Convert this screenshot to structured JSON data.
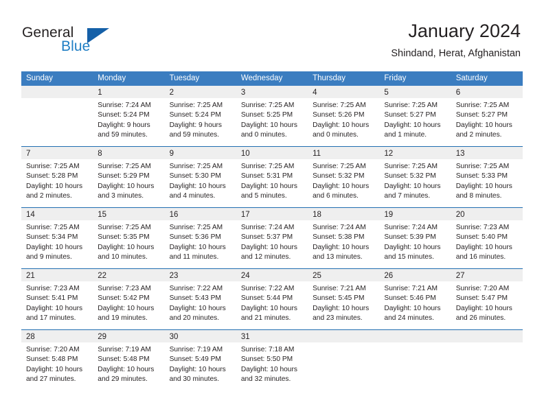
{
  "brand": {
    "name_part1": "General",
    "name_part2": "Blue",
    "accent_color": "#1f7ec4",
    "triangle_color": "#1560a8"
  },
  "header": {
    "title": "January 2024",
    "location": "Shindand, Herat, Afghanistan"
  },
  "theme": {
    "header_blue": "#3b7dc0",
    "row_separator_blue": "#1f6cb0",
    "date_band_gray": "#efefef",
    "text_color": "#231f20"
  },
  "weekdays": [
    "Sunday",
    "Monday",
    "Tuesday",
    "Wednesday",
    "Thursday",
    "Friday",
    "Saturday"
  ],
  "weeks": [
    [
      {
        "day": "",
        "lines": []
      },
      {
        "day": "1",
        "lines": [
          "Sunrise: 7:24 AM",
          "Sunset: 5:24 PM",
          "Daylight: 9 hours",
          "and 59 minutes."
        ]
      },
      {
        "day": "2",
        "lines": [
          "Sunrise: 7:25 AM",
          "Sunset: 5:24 PM",
          "Daylight: 9 hours",
          "and 59 minutes."
        ]
      },
      {
        "day": "3",
        "lines": [
          "Sunrise: 7:25 AM",
          "Sunset: 5:25 PM",
          "Daylight: 10 hours",
          "and 0 minutes."
        ]
      },
      {
        "day": "4",
        "lines": [
          "Sunrise: 7:25 AM",
          "Sunset: 5:26 PM",
          "Daylight: 10 hours",
          "and 0 minutes."
        ]
      },
      {
        "day": "5",
        "lines": [
          "Sunrise: 7:25 AM",
          "Sunset: 5:27 PM",
          "Daylight: 10 hours",
          "and 1 minute."
        ]
      },
      {
        "day": "6",
        "lines": [
          "Sunrise: 7:25 AM",
          "Sunset: 5:27 PM",
          "Daylight: 10 hours",
          "and 2 minutes."
        ]
      }
    ],
    [
      {
        "day": "7",
        "lines": [
          "Sunrise: 7:25 AM",
          "Sunset: 5:28 PM",
          "Daylight: 10 hours",
          "and 2 minutes."
        ]
      },
      {
        "day": "8",
        "lines": [
          "Sunrise: 7:25 AM",
          "Sunset: 5:29 PM",
          "Daylight: 10 hours",
          "and 3 minutes."
        ]
      },
      {
        "day": "9",
        "lines": [
          "Sunrise: 7:25 AM",
          "Sunset: 5:30 PM",
          "Daylight: 10 hours",
          "and 4 minutes."
        ]
      },
      {
        "day": "10",
        "lines": [
          "Sunrise: 7:25 AM",
          "Sunset: 5:31 PM",
          "Daylight: 10 hours",
          "and 5 minutes."
        ]
      },
      {
        "day": "11",
        "lines": [
          "Sunrise: 7:25 AM",
          "Sunset: 5:32 PM",
          "Daylight: 10 hours",
          "and 6 minutes."
        ]
      },
      {
        "day": "12",
        "lines": [
          "Sunrise: 7:25 AM",
          "Sunset: 5:32 PM",
          "Daylight: 10 hours",
          "and 7 minutes."
        ]
      },
      {
        "day": "13",
        "lines": [
          "Sunrise: 7:25 AM",
          "Sunset: 5:33 PM",
          "Daylight: 10 hours",
          "and 8 minutes."
        ]
      }
    ],
    [
      {
        "day": "14",
        "lines": [
          "Sunrise: 7:25 AM",
          "Sunset: 5:34 PM",
          "Daylight: 10 hours",
          "and 9 minutes."
        ]
      },
      {
        "day": "15",
        "lines": [
          "Sunrise: 7:25 AM",
          "Sunset: 5:35 PM",
          "Daylight: 10 hours",
          "and 10 minutes."
        ]
      },
      {
        "day": "16",
        "lines": [
          "Sunrise: 7:25 AM",
          "Sunset: 5:36 PM",
          "Daylight: 10 hours",
          "and 11 minutes."
        ]
      },
      {
        "day": "17",
        "lines": [
          "Sunrise: 7:24 AM",
          "Sunset: 5:37 PM",
          "Daylight: 10 hours",
          "and 12 minutes."
        ]
      },
      {
        "day": "18",
        "lines": [
          "Sunrise: 7:24 AM",
          "Sunset: 5:38 PM",
          "Daylight: 10 hours",
          "and 13 minutes."
        ]
      },
      {
        "day": "19",
        "lines": [
          "Sunrise: 7:24 AM",
          "Sunset: 5:39 PM",
          "Daylight: 10 hours",
          "and 15 minutes."
        ]
      },
      {
        "day": "20",
        "lines": [
          "Sunrise: 7:23 AM",
          "Sunset: 5:40 PM",
          "Daylight: 10 hours",
          "and 16 minutes."
        ]
      }
    ],
    [
      {
        "day": "21",
        "lines": [
          "Sunrise: 7:23 AM",
          "Sunset: 5:41 PM",
          "Daylight: 10 hours",
          "and 17 minutes."
        ]
      },
      {
        "day": "22",
        "lines": [
          "Sunrise: 7:23 AM",
          "Sunset: 5:42 PM",
          "Daylight: 10 hours",
          "and 19 minutes."
        ]
      },
      {
        "day": "23",
        "lines": [
          "Sunrise: 7:22 AM",
          "Sunset: 5:43 PM",
          "Daylight: 10 hours",
          "and 20 minutes."
        ]
      },
      {
        "day": "24",
        "lines": [
          "Sunrise: 7:22 AM",
          "Sunset: 5:44 PM",
          "Daylight: 10 hours",
          "and 21 minutes."
        ]
      },
      {
        "day": "25",
        "lines": [
          "Sunrise: 7:21 AM",
          "Sunset: 5:45 PM",
          "Daylight: 10 hours",
          "and 23 minutes."
        ]
      },
      {
        "day": "26",
        "lines": [
          "Sunrise: 7:21 AM",
          "Sunset: 5:46 PM",
          "Daylight: 10 hours",
          "and 24 minutes."
        ]
      },
      {
        "day": "27",
        "lines": [
          "Sunrise: 7:20 AM",
          "Sunset: 5:47 PM",
          "Daylight: 10 hours",
          "and 26 minutes."
        ]
      }
    ],
    [
      {
        "day": "28",
        "lines": [
          "Sunrise: 7:20 AM",
          "Sunset: 5:48 PM",
          "Daylight: 10 hours",
          "and 27 minutes."
        ]
      },
      {
        "day": "29",
        "lines": [
          "Sunrise: 7:19 AM",
          "Sunset: 5:48 PM",
          "Daylight: 10 hours",
          "and 29 minutes."
        ]
      },
      {
        "day": "30",
        "lines": [
          "Sunrise: 7:19 AM",
          "Sunset: 5:49 PM",
          "Daylight: 10 hours",
          "and 30 minutes."
        ]
      },
      {
        "day": "31",
        "lines": [
          "Sunrise: 7:18 AM",
          "Sunset: 5:50 PM",
          "Daylight: 10 hours",
          "and 32 minutes."
        ]
      },
      {
        "day": "",
        "lines": []
      },
      {
        "day": "",
        "lines": []
      },
      {
        "day": "",
        "lines": []
      }
    ]
  ]
}
